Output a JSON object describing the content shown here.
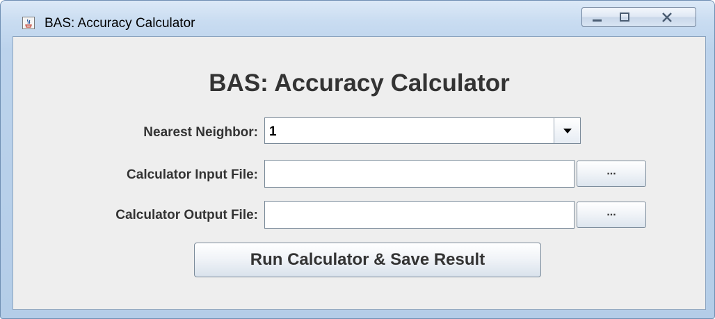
{
  "window": {
    "title": "BAS: Accuracy Calculator",
    "icon": "java-cup-icon",
    "controls": [
      "minimize-icon",
      "maximize-icon",
      "close-icon"
    ]
  },
  "form": {
    "heading": "BAS: Accuracy Calculator",
    "nearest_neighbor": {
      "label": "Nearest Neighbor:",
      "value": "1"
    },
    "input_file": {
      "label": "Calculator Input File:",
      "value": "",
      "browse_label": "..."
    },
    "output_file": {
      "label": "Calculator Output File:",
      "value": "",
      "browse_label": "..."
    },
    "run_button": "Run Calculator & Save Result"
  },
  "colors": {
    "frame": "#bcd3ec",
    "panel": "#eeeeee",
    "text": "#333333"
  }
}
